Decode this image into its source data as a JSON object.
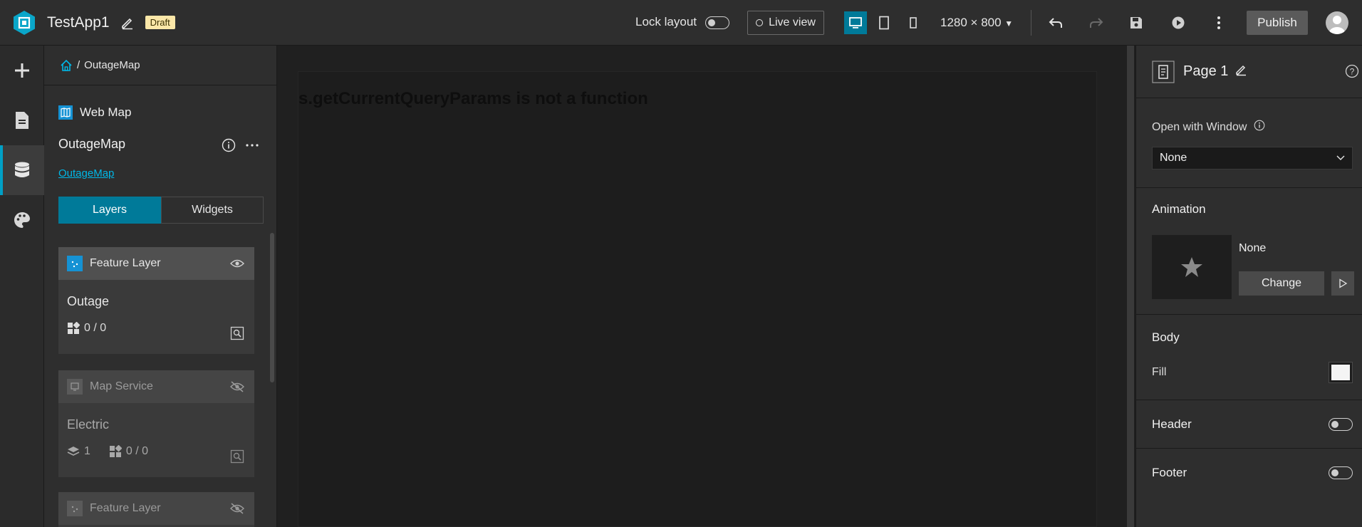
{
  "topbar": {
    "app_title": "TestApp1",
    "status_badge": "Draft",
    "lock_layout_label": "Lock layout",
    "live_view_label": "Live view",
    "resolution": "1280 × 800",
    "publish_label": "Publish"
  },
  "breadcrumb": {
    "separator": "/",
    "current": "OutageMap"
  },
  "data_source": {
    "type_label": "Web Map",
    "name": "OutageMap",
    "link_text": "OutageMap",
    "tabs": [
      "Layers",
      "Widgets"
    ],
    "layers": [
      {
        "type": "Feature Layer",
        "name": "Outage",
        "counts": "0 / 0",
        "visible": true
      },
      {
        "type": "Map Service",
        "name": "Electric",
        "sublayers": "1",
        "counts": "0 / 0",
        "visible": false
      },
      {
        "type": "Feature Layer",
        "visible": false
      }
    ]
  },
  "canvas": {
    "error_text": "s.getCurrentQueryParams is not a function"
  },
  "properties": {
    "page_title": "Page 1",
    "open_with_window_label": "Open with Window",
    "open_with_window_value": "None",
    "animation_label": "Animation",
    "animation_value": "None",
    "change_label": "Change",
    "body_label": "Body",
    "fill_label": "Fill",
    "header_label": "Header",
    "footer_label": "Footer"
  },
  "colors": {
    "accent": "#007a99",
    "link": "#00b7e6",
    "draft_badge": "#fbe7a8",
    "background": "#1f1f1f"
  }
}
